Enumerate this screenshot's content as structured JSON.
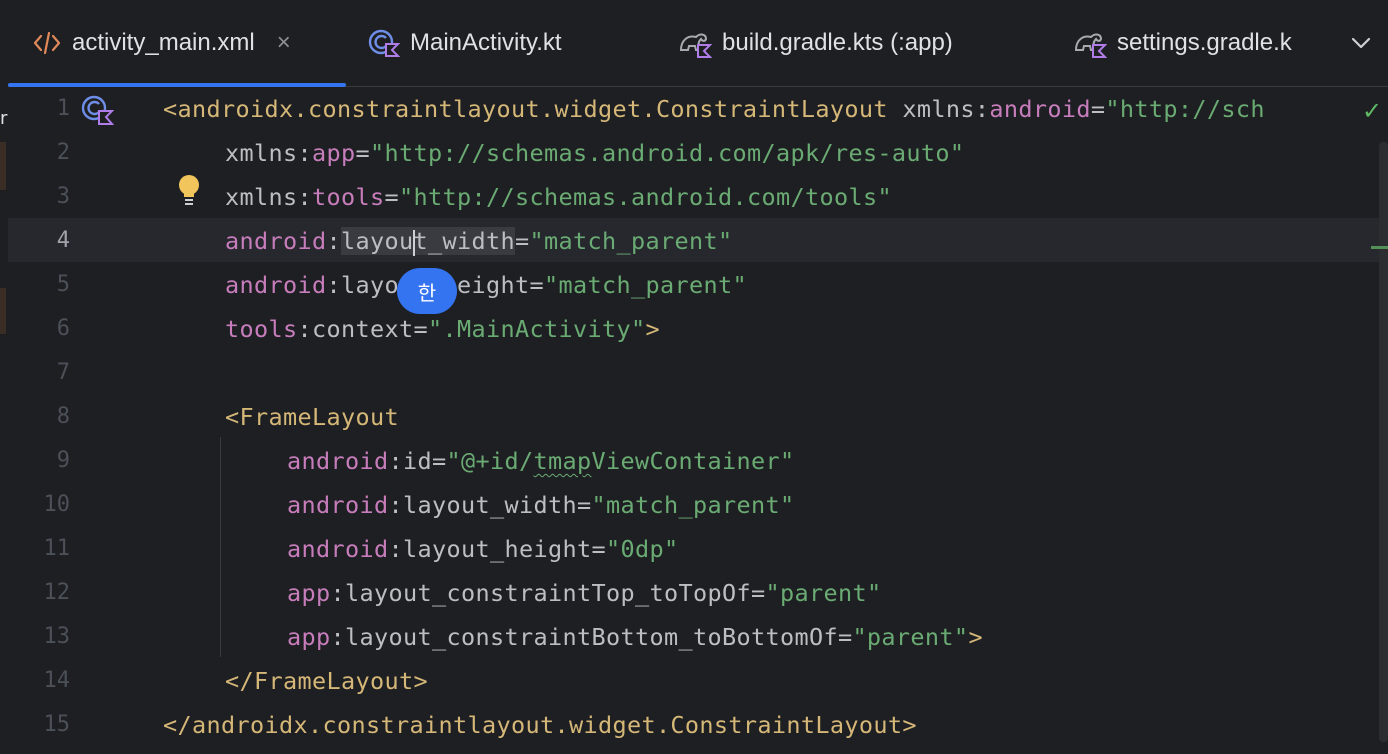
{
  "tabs": [
    {
      "label": "activity_main.xml",
      "icon": "xml-icon",
      "active": true,
      "close": "×"
    },
    {
      "label": "MainActivity.kt",
      "icon": "kotlin-class-icon"
    },
    {
      "label": "build.gradle.kts (:app)",
      "icon": "gradle-kts-icon"
    },
    {
      "label": "settings.gradle.k",
      "icon": "gradle-kts-icon"
    }
  ],
  "left_strip": {
    "char": "r"
  },
  "editor": {
    "ime_indicator": "한",
    "current_line": 4,
    "lines": [
      {
        "n": "1"
      },
      {
        "n": "2"
      },
      {
        "n": "3"
      },
      {
        "n": "4"
      },
      {
        "n": "5"
      },
      {
        "n": "6"
      },
      {
        "n": "7"
      },
      {
        "n": "8"
      },
      {
        "n": "9"
      },
      {
        "n": "10"
      },
      {
        "n": "11"
      },
      {
        "n": "12"
      },
      {
        "n": "13"
      },
      {
        "n": "14"
      },
      {
        "n": "15"
      }
    ],
    "code": {
      "l1_a": "<androidx.constraintlayout.widget.ConstraintLayout",
      "l1_b": " xmlns:",
      "l1_c": "android",
      "l1_d": "=",
      "l1_e": "\"http://sch",
      "l2_a": "xmlns:",
      "l2_b": "app",
      "l2_c": "=",
      "l2_d": "\"http://schemas.android.com/apk/res-auto\"",
      "l3_a": "xmlns:",
      "l3_b": "tools",
      "l3_c": "=",
      "l3_d": "\"http://schemas.android.com/tools\"",
      "l4_a": "android",
      "l4_b": ":",
      "l4_c": "layou",
      "l4_d": "t_width",
      "l4_e": "=",
      "l4_f": "\"match_parent\"",
      "l5_a": "android",
      "l5_b": ":layout_height",
      "l5_c": "=",
      "l5_d": "\"match_parent\"",
      "l6_a": "tools",
      "l6_b": ":context",
      "l6_c": "=",
      "l6_d": "\".MainActivity\"",
      "l6_e": ">",
      "l8_a": "<FrameLayout",
      "l9_a": "android",
      "l9_b": ":id",
      "l9_c": "=",
      "l9_d": "\"@+id/",
      "l9_e": "tmap",
      "l9_f": "ViewContainer\"",
      "l10_a": "android",
      "l10_b": ":layout_width",
      "l10_c": "=",
      "l10_d": "\"match_parent\"",
      "l11_a": "android",
      "l11_b": ":layout_height",
      "l11_c": "=",
      "l11_d": "\"0dp\"",
      "l12_a": "app",
      "l12_b": ":layout_constraintTop_toTopOf",
      "l12_c": "=",
      "l12_d": "\"parent\"",
      "l13_a": "app",
      "l13_b": ":layout_constraintBottom_toBottomOf",
      "l13_c": "=",
      "l13_d": "\"parent\"",
      "l13_e": ">",
      "l14_a": "</FrameLayout>",
      "l15_a": "</androidx.constraintlayout.widget.ConstraintLayout>"
    }
  },
  "colors": {
    "background": "#1e1f22",
    "accent": "#3574f0",
    "tag": "#d5b778",
    "namespace": "#c77dbb",
    "string": "#6aab73",
    "text": "#bcbec4"
  }
}
